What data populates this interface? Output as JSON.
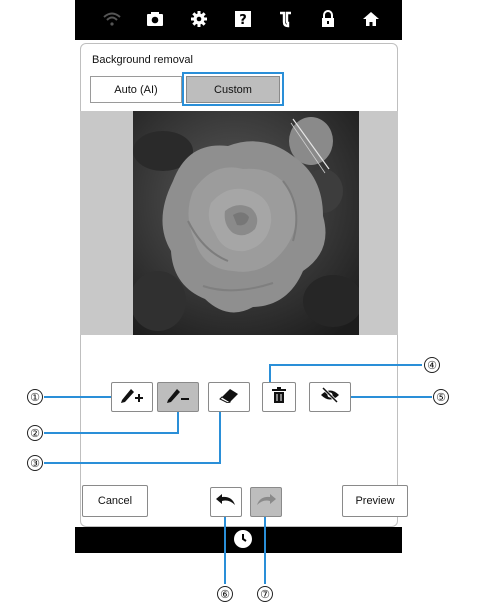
{
  "screen": {
    "title": "Background removal",
    "tabs": {
      "auto_label": "Auto (AI)",
      "custom_label": "Custom"
    },
    "buttons": {
      "cancel_label": "Cancel",
      "preview_label": "Preview"
    }
  },
  "topbar_icons": [
    "wifi-icon",
    "camera-icon",
    "settings-gear-icon",
    "help-icon",
    "embroidery-icon",
    "lock-icon",
    "home-icon"
  ],
  "tools": [
    {
      "name": "add-area-pen",
      "icon": "pen-plus-icon",
      "selected": false
    },
    {
      "name": "remove-area-pen",
      "icon": "pen-minus-icon",
      "selected": true
    },
    {
      "name": "eraser",
      "icon": "eraser-icon",
      "selected": false
    },
    {
      "name": "delete",
      "icon": "trash-icon",
      "selected": false
    },
    {
      "name": "hide-preview",
      "icon": "eye-slash-icon",
      "selected": false
    }
  ],
  "history": {
    "undo_icon": "undo-icon",
    "redo_icon": "redo-icon",
    "redo_enabled": false
  },
  "callouts": [
    "①",
    "②",
    "③",
    "④",
    "⑤",
    "⑥",
    "⑦"
  ],
  "colors": {
    "highlight": "#2a8fd8",
    "selected_bg": "#bdbdbd",
    "bar": "#000000"
  }
}
